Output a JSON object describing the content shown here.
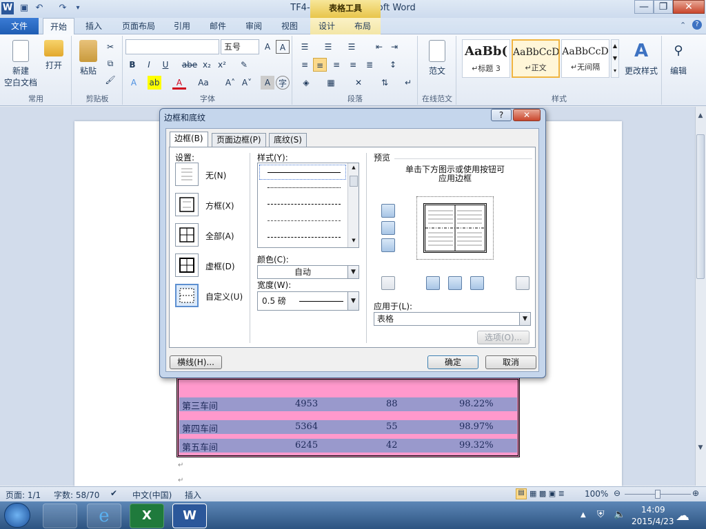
{
  "window": {
    "title": "TF4-1.docx - Microsoft Word",
    "context_tab_group": "表格工具",
    "controls": [
      "—",
      "❐",
      "✕"
    ]
  },
  "tabs": {
    "file": "文件",
    "items": [
      "开始",
      "插入",
      "页面布局",
      "引用",
      "邮件",
      "审阅",
      "视图",
      "设计",
      "布局"
    ],
    "active": "开始"
  },
  "ribbon": {
    "common": {
      "new_label": "新建\n空白文档",
      "new_line1": "新建",
      "new_line2": "空白文档",
      "open_label": "打开",
      "group": "常用"
    },
    "clipboard": {
      "paste_label": "粘贴",
      "group": "剪贴板"
    },
    "font": {
      "font_name": "",
      "font_size": "五号",
      "group": "字体",
      "bold": "B",
      "italic": "I",
      "underline": "U",
      "strike": "abe",
      "sub": "x₂",
      "sup": "x²",
      "grow": "A˄",
      "shrink": "A˅",
      "case": "Aa"
    },
    "paragraph": {
      "group": "段落"
    },
    "online": {
      "label": "范文",
      "group": "在线范文"
    },
    "styles": {
      "items": [
        {
          "sample": "AaBb(",
          "name": "↵标题 3"
        },
        {
          "sample": "AaBbCcD",
          "name": "↵正文"
        },
        {
          "sample": "AaBbCcD",
          "name": "↵无间隔"
        }
      ],
      "change": "更改样式",
      "group": "样式"
    },
    "edit": {
      "label": "编辑"
    }
  },
  "table": {
    "rows": [
      {
        "name": "第三车间",
        "v1": "4953",
        "v2": "88",
        "v3": "98.22%"
      },
      {
        "name": "第四车间",
        "v1": "5364",
        "v2": "55",
        "v3": "98.97%"
      },
      {
        "name": "第五车间",
        "v1": "6245",
        "v2": "42",
        "v3": "99.32%"
      }
    ]
  },
  "dialog": {
    "title": "边框和底纹",
    "help": "?",
    "close": "✕",
    "tabs": [
      "边框(B)",
      "页面边框(P)",
      "底纹(S)"
    ],
    "settings_label": "设置:",
    "settings": [
      "无(N)",
      "方框(X)",
      "全部(A)",
      "虚框(D)",
      "自定义(U)"
    ],
    "style_label": "样式(Y):",
    "color_label": "颜色(C):",
    "color_value": "自动",
    "width_label": "宽度(W):",
    "width_value": "0.5 磅",
    "preview_label": "预览",
    "preview_hint_1": "单击下方图示或使用按钮可",
    "preview_hint_2": "应用边框",
    "apply_label": "应用于(L):",
    "apply_value": "表格",
    "options": "选项(O)...",
    "hline": "横线(H)...",
    "ok": "确定",
    "cancel": "取消"
  },
  "status": {
    "page": "页面: 1/1",
    "words": "字数: 58/70",
    "lang": "中文(中国)",
    "mode": "插入",
    "zoom": "100%"
  },
  "taskbar": {
    "time": "14:09",
    "date": "2015/4/23"
  }
}
